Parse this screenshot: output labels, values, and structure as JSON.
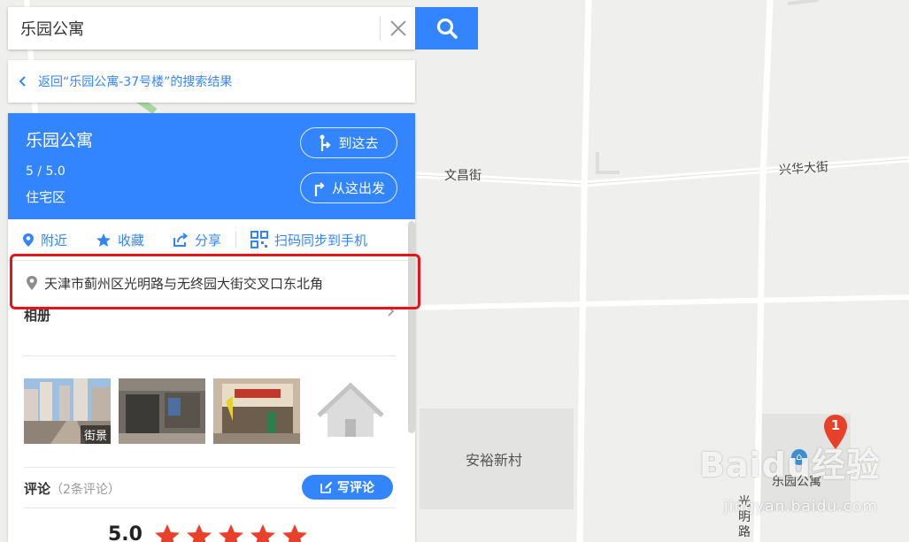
{
  "search": {
    "value": "乐园公寓"
  },
  "back_link": "返回“乐园公寓-37号楼”的搜索结果",
  "poi": {
    "name": "乐园公寓",
    "rating": "5 / 5.0",
    "type": "住宅区",
    "go_here_label": "到这去",
    "start_here_label": "从这出发"
  },
  "actions": {
    "nearby": "附近",
    "favorite": "收藏",
    "share": "分享",
    "scan_sync": "扫码同步到手机"
  },
  "address": "天津市蓟州区光明路与无终园大街交叉口东北角",
  "album": {
    "title": "相册",
    "street_view_tag": "街景"
  },
  "comments": {
    "title": "评论",
    "count": "（2条评论）",
    "write_label": "写评论",
    "score": "5.0",
    "stars": 5
  },
  "map": {
    "streets": [
      "文昌街",
      "兴华大街",
      "安裕新村",
      "光明路"
    ],
    "marker_number": "1",
    "poi_label": "乐园公寓"
  },
  "watermark": {
    "brand": "Baidu经验",
    "url": "jingyan.baidu.com"
  },
  "colors": {
    "accent": "#3385ff",
    "highlight": "#e3141c",
    "marker": "#e8402a"
  }
}
